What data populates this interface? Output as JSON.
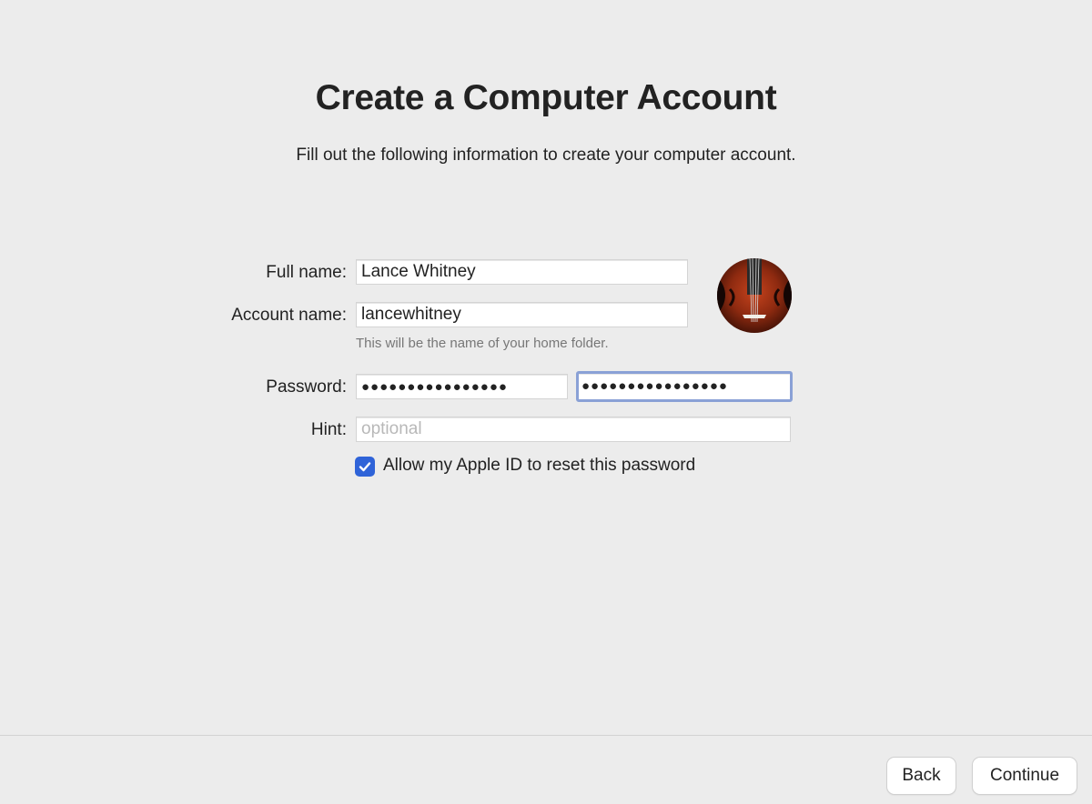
{
  "header": {
    "title": "Create a Computer Account",
    "subtitle": "Fill out the following information to create your computer account."
  },
  "form": {
    "full_name": {
      "label": "Full name:",
      "value": "Lance Whitney"
    },
    "account_name": {
      "label": "Account name:",
      "value": "lancewhitney",
      "help": "This will be the name of your home folder."
    },
    "password": {
      "label": "Password:",
      "value": "●●●●●●●●●●●●●●●●",
      "verify_value": "●●●●●●●●●●●●●●●●"
    },
    "hint": {
      "label": "Hint:",
      "value": "",
      "placeholder": "optional"
    },
    "apple_id_reset": {
      "label": "Allow my Apple ID to reset this password",
      "checked": true
    },
    "avatar_icon": "violin-avatar-icon"
  },
  "footer": {
    "back_label": "Back",
    "continue_label": "Continue"
  },
  "colors": {
    "background": "#ececec",
    "accent": "#2f63d8",
    "focus_ring": "#8aa1d6"
  }
}
